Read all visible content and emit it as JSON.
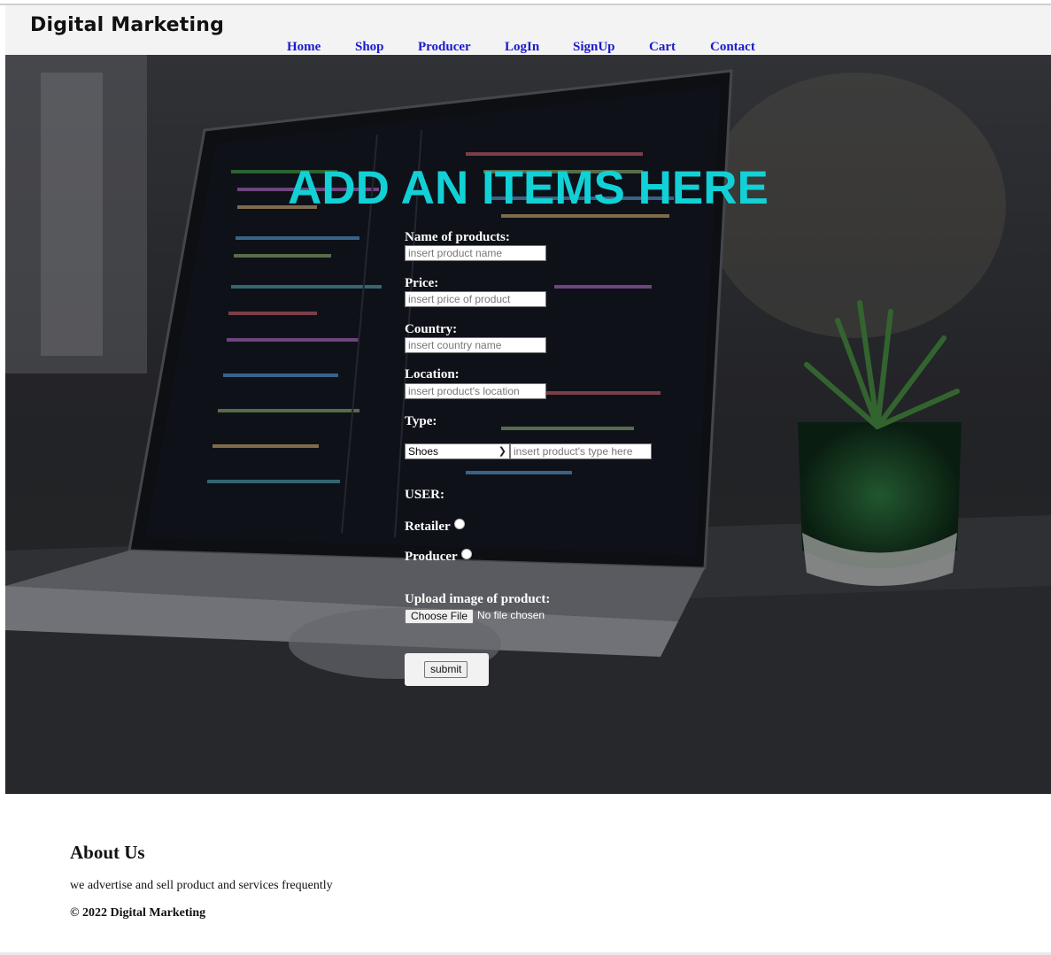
{
  "header": {
    "brand": "Digital Marketing",
    "nav": [
      "Home",
      "Shop",
      "Producer",
      "LogIn",
      "SignUp",
      "Cart",
      "Contact"
    ]
  },
  "hero": {
    "title": "ADD AN ITEMS HERE"
  },
  "form": {
    "name_label": "Name of products:",
    "name_placeholder": "insert product name",
    "price_label": "Price:",
    "price_placeholder": "insert price of product",
    "country_label": "Country:",
    "country_placeholder": "insert country name",
    "location_label": "Location:",
    "location_placeholder": "insert product's location",
    "type_label": "Type:",
    "type_selected": "Shoes",
    "type_placeholder": "insert product's type here",
    "user_label": "USER:",
    "retailer_label": "Retailer",
    "producer_label": "Producer",
    "upload_label": "Upload image of product:",
    "choose_file_label": "Choose File",
    "file_status": "No file chosen",
    "submit_label": "submit"
  },
  "footer": {
    "about_title": "About Us",
    "about_text": "we advertise and sell product and services frequently",
    "copyright": "© 2022 Digital Marketing"
  },
  "colors": {
    "accent_title": "#12d1d6",
    "nav_link": "#1a1acc"
  }
}
